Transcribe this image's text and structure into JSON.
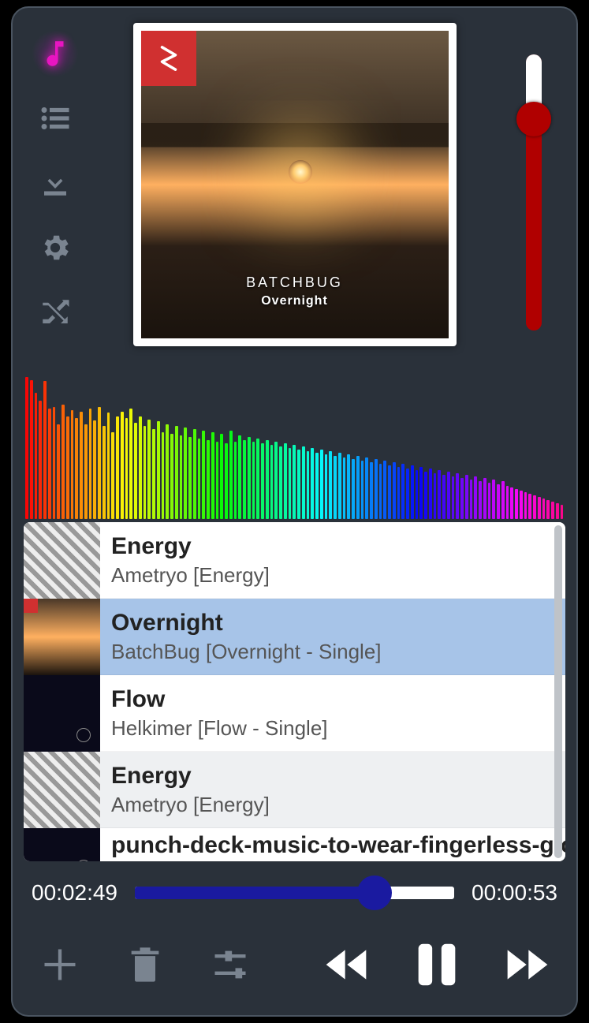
{
  "album": {
    "artist_label": "BATCHBUG",
    "title_label": "Overnight"
  },
  "playlist": [
    {
      "title": "Energy",
      "subtitle": "Ametryo [Energy]",
      "thumb": "energy",
      "selected": false
    },
    {
      "title": "Overnight",
      "subtitle": "BatchBug [Overnight - Single]",
      "thumb": "overnight",
      "selected": true
    },
    {
      "title": "Flow",
      "subtitle": "Helkimer [Flow - Single]",
      "thumb": "flow",
      "selected": false
    },
    {
      "title": "Energy",
      "subtitle": "Ametryo [Energy]",
      "thumb": "energy",
      "selected": false
    },
    {
      "title": "punch-deck-music-to-wear-fingerless-glo",
      "subtitle": "",
      "thumb": "flow",
      "selected": false,
      "partial": true
    }
  ],
  "progress": {
    "elapsed": "00:02:49",
    "remaining": "00:00:53",
    "percent": 75
  },
  "visualizer_bars": [
    180,
    176,
    160,
    150,
    175,
    140,
    142,
    120,
    145,
    130,
    138,
    128,
    136,
    120,
    140,
    125,
    142,
    118,
    135,
    110,
    130,
    136,
    128,
    140,
    122,
    130,
    118,
    126,
    114,
    124,
    110,
    120,
    108,
    118,
    106,
    116,
    104,
    114,
    102,
    112,
    100,
    110,
    98,
    108,
    96,
    112,
    98,
    106,
    100,
    104,
    98,
    102,
    96,
    100,
    94,
    98,
    92,
    96,
    90,
    94,
    88,
    92,
    86,
    90,
    84,
    88,
    82,
    86,
    80,
    84,
    78,
    82,
    76,
    80,
    74,
    78,
    72,
    76,
    70,
    74,
    68,
    72,
    66,
    70,
    64,
    68,
    62,
    66,
    60,
    64,
    58,
    62,
    56,
    60,
    54,
    58,
    52,
    56,
    50,
    54,
    48,
    52,
    46,
    50,
    44,
    48,
    42,
    40,
    38,
    36,
    34,
    32,
    30,
    28,
    26,
    24,
    22,
    20,
    18
  ]
}
